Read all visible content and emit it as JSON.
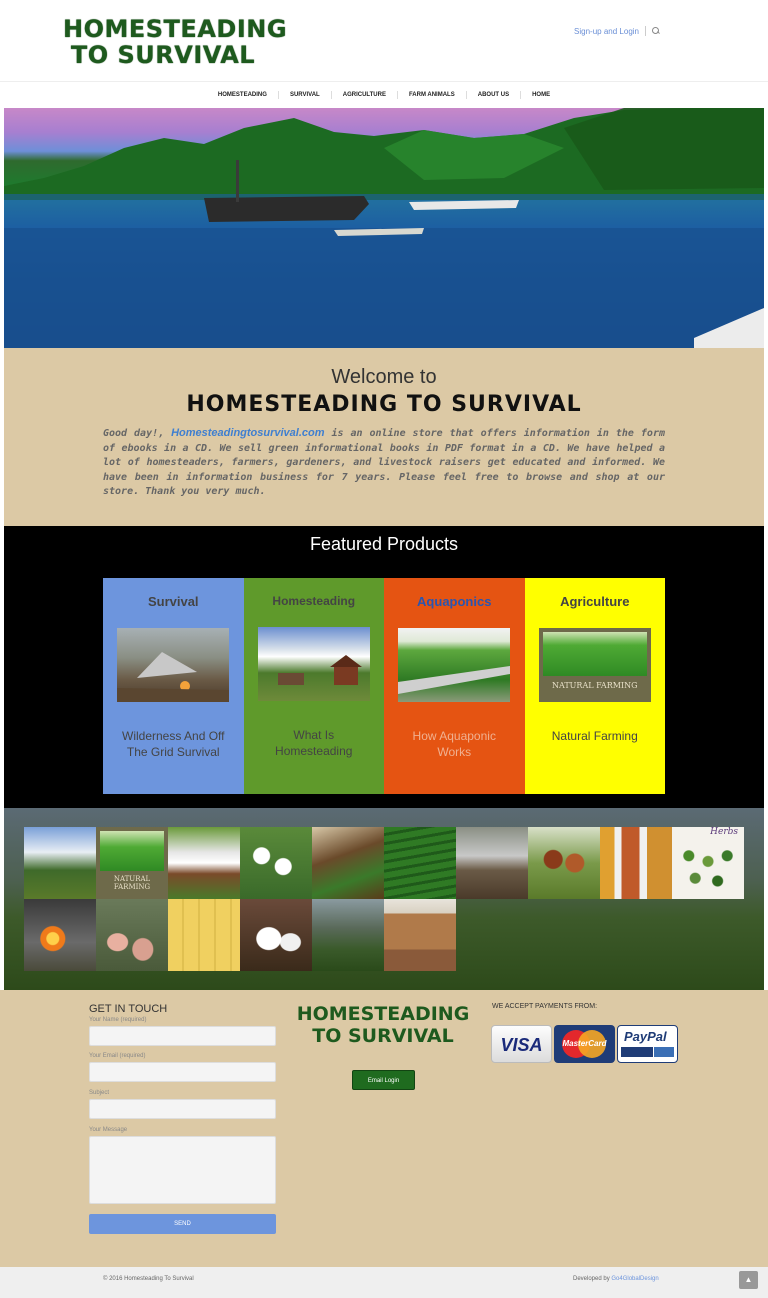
{
  "header": {
    "logo_line1": "HOMESTEADING",
    "logo_line2": "TO SURVIVAL",
    "signup_login": "Sign-up and Login"
  },
  "nav": {
    "items": [
      "HOMESTEADING",
      "SURVIVAL",
      "AGRICULTURE",
      "FARM ANIMALS",
      "ABOUT US",
      "HOME"
    ]
  },
  "welcome": {
    "heading": "Welcome to",
    "title": "HOMESTEADING TO SURVIVAL",
    "intro_before_link": "Good day!, ",
    "link": "Homesteadingtosurvival.com",
    "intro_after_link": " is an online store that offers information in the form of ebooks in a CD. We sell green informational books in PDF format in a CD. We have helped a lot of homesteaders, farmers, gardeners, and livestock raisers get educated and informed. We have been in information business for 7 years. Please feel free to browse and shop at our store. Thank you very much."
  },
  "featured": {
    "heading": "Featured Products",
    "cards": [
      {
        "category": "Survival",
        "product": "Wilderness And Off The Grid Survival",
        "color": "#6d95dd"
      },
      {
        "category": "Homesteading",
        "product": "What Is Homesteading",
        "color": "#5f9a2b"
      },
      {
        "category": "Aquaponics",
        "product": "How Aquaponic Works",
        "color": "#e55412"
      },
      {
        "category": "Agriculture",
        "product": "Natural Farming",
        "color": "#ffff00"
      }
    ],
    "natural_farming_cover": "NATURAL FARMING"
  },
  "gallery": {
    "natural_farming_tile": "NATURAL FARMING",
    "herbs_tile": "Herbs"
  },
  "contact": {
    "heading": "GET IN TOUCH",
    "name_label": "Your Name (required)",
    "email_label": "Your Email (required)",
    "subject_label": "Subject",
    "message_label": "Your Message",
    "send": "SEND",
    "logo_line1": "HOMESTEADING",
    "logo_line2": "TO SURVIVAL",
    "email_login": "Email Login",
    "payments_heading": "WE ACCEPT PAYMENTS FROM:",
    "visa": "VISA",
    "mastercard": "MasterCard",
    "paypal": "PayPal"
  },
  "footer": {
    "copyright": "© 2016 Homesteading To Survival",
    "developed_by": "Developed by ",
    "developer": "Go4GlobalDesign"
  }
}
